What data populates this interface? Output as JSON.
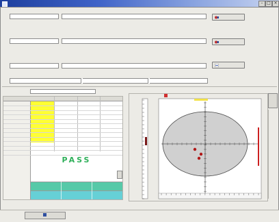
{
  "window": {
    "title": ""
  },
  "sections": {
    "standard": "",
    "sample": "",
    "product": "",
    "recipe": ""
  },
  "standard": {
    "field1": "",
    "field2": "",
    "measurement_label": "",
    "measurement_value": "",
    "measure_button": ""
  },
  "sample": {
    "field1": "",
    "field2": "",
    "measurement_label": "",
    "measurement_value": "",
    "measure_button": ""
  },
  "product": {
    "field1": "",
    "field2": "",
    "tolerance_button": ""
  },
  "recipe": {
    "field": ""
  },
  "tolerance_panel": {
    "label": "",
    "value": ""
  },
  "results": {
    "rows": [
      {
        "label": ""
      },
      {
        "label": ""
      },
      {
        "label": ""
      },
      {
        "label": ""
      },
      {
        "label": ""
      },
      {
        "label": ""
      },
      {
        "label": ""
      },
      {
        "label": ""
      },
      {
        "label": ""
      },
      {
        "label": ""
      },
      {
        "label": ""
      },
      {
        "label": ""
      }
    ],
    "status": "PASS",
    "colors": {
      "status_bg": "#ffff33",
      "status_text": "#2fb05a",
      "swatch_top": "#56c9a8",
      "swatch_bottom": "#66d0d6"
    }
  },
  "plot": {
    "legend_label": "",
    "marker_color": "#b01818",
    "ellipse_color": "#d0d0d0"
  },
  "side_panel": {
    "tab_label": ""
  },
  "bottom": {
    "tab_label": ""
  }
}
